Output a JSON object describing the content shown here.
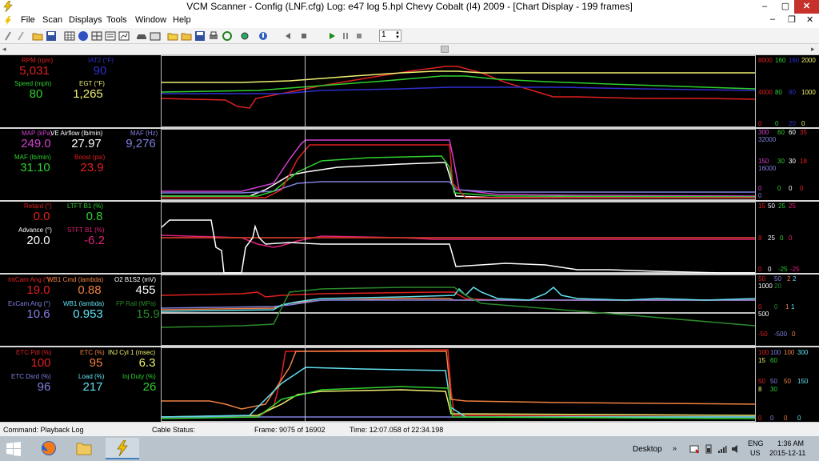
{
  "titlebar": {
    "title": "VCM Scanner  -  Config  (LNF.cfg)    Log:  e47 log 5.hpl    Chevy Cobalt  (I4) 2009  -  [Chart Display  -  199 frames]",
    "minimize": "–",
    "maximize": "▢",
    "close": "✕"
  },
  "menubar": {
    "items": [
      "File",
      "Scan",
      "Displays",
      "Tools",
      "Window",
      "Help"
    ]
  },
  "toolbar": {
    "frame_step": "1"
  },
  "panels": [
    {
      "labels": [
        {
          "text": "RPM (rpm)",
          "value": "5,031",
          "color": "#e02020"
        },
        {
          "text": "IAT2 (°F)",
          "value": "90",
          "color": "#2f2fd0"
        },
        {
          "text": "Speed (mph)",
          "value": "80",
          "color": "#2ed02e"
        },
        {
          "text": "EGT (°F)",
          "value": "1,265",
          "color": "#f0f070"
        }
      ],
      "scales_top": [
        "8000",
        "160",
        "160",
        "2000"
      ],
      "scales_mid": [
        "4000",
        "80",
        "90",
        "1000"
      ],
      "scales_bot": [
        "0",
        "0",
        "20",
        "0"
      ]
    },
    {
      "labels": [
        {
          "text": "MAP (kPa)",
          "value": "249.0",
          "color": "#d040d0"
        },
        {
          "text": "VE Airflow (lb/min)",
          "value": "27.97",
          "color": "#ffffff"
        },
        {
          "text": "MAF (Hz)",
          "value": "9,276",
          "color": "#8080e0"
        },
        {
          "text": "MAF (lb/min)",
          "value": "31.10",
          "color": "#2ed02e"
        },
        {
          "text": "Boost (psi)",
          "value": "23.9",
          "color": "#e02020"
        }
      ],
      "scales_top": [
        "300",
        "60",
        "60",
        "35"
      ],
      "scales_top2": [
        "32000"
      ],
      "scales_mid": [
        "150",
        "30",
        "30",
        "18"
      ],
      "scales_mid2": [
        "16000"
      ],
      "scales_bot": [
        "0",
        "0",
        "0",
        "0"
      ],
      "scales_bot2": [
        "0"
      ]
    },
    {
      "labels": [
        {
          "text": "Retard (°)",
          "value": "0.0",
          "color": "#e02020"
        },
        {
          "text": "LTFT B1 (%)",
          "value": "0.8",
          "color": "#2ed02e"
        },
        {
          "text": "Advance (°)",
          "value": "20.0",
          "color": "#ffffff"
        },
        {
          "text": "STFT B1 (%)",
          "value": "-6.2",
          "color": "#e0207a"
        }
      ],
      "scales_top": [
        "15",
        "50",
        "25",
        "25"
      ],
      "scales_mid": [
        "8",
        "25",
        "0",
        "0"
      ],
      "scales_bot": [
        "0",
        "0",
        "-25",
        "-25"
      ]
    },
    {
      "labels": [
        {
          "text": "IntCam Ang (°)",
          "value": "19.0",
          "color": "#e02020"
        },
        {
          "text": "WB1 Cmd (lambda)",
          "value": "0.88",
          "color": "#f08040"
        },
        {
          "text": "O2 B1S2 (mV)",
          "value": "455",
          "color": "#ffffff"
        },
        {
          "text": "ExCam Ang (°)",
          "value": "10.6",
          "color": "#8080e0"
        },
        {
          "text": "WB1 (lambda)",
          "value": "0.953",
          "color": "#60e0f0"
        },
        {
          "text": "FP Rail (MPa)",
          "value": "15.9",
          "color": "#2a8a2a"
        }
      ],
      "scales_top": [
        "50",
        "50",
        "2",
        "2"
      ],
      "scales_top2": [
        "1000",
        "20"
      ],
      "scales_mid": [
        "0",
        "1",
        "1"
      ],
      "scales_mid2": [
        "500",
        "0"
      ],
      "scales_bot": [
        "-50",
        "-500",
        "0"
      ]
    },
    {
      "labels": [
        {
          "text": "ETC Pdl (%)",
          "value": "100",
          "color": "#e02020"
        },
        {
          "text": "ETC (%)",
          "value": "95",
          "color": "#f08040"
        },
        {
          "text": "INJ Cyl 1 (msec)",
          "value": "6.3",
          "color": "#f0f070"
        },
        {
          "text": "ETC Dsrd (%)",
          "value": "96",
          "color": "#8080e0"
        },
        {
          "text": "Load (%)",
          "value": "217",
          "color": "#60e0f0"
        },
        {
          "text": "Inj Duty (%)",
          "value": "26",
          "color": "#2ed02e"
        }
      ],
      "scales_top": [
        "100",
        "100",
        "100",
        "300"
      ],
      "scales_top2": [
        "15",
        "60"
      ],
      "scales_mid": [
        "50",
        "50",
        "50",
        "150"
      ],
      "scales_mid2": [
        "8",
        "30"
      ],
      "scales_bot": [
        "0",
        "0",
        "0",
        "0"
      ]
    }
  ],
  "statusbar": {
    "command": "Command:  Playback Log",
    "cable": "Cable Status:",
    "frame": "Frame:  9075 of 16902",
    "time": "Time:  12:07.058 of 22:34.198"
  },
  "taskbar": {
    "desktop": "Desktop",
    "lang": "ENG",
    "region": "US",
    "clock_time": "1:36 AM",
    "clock_date": "2015-12-11"
  }
}
